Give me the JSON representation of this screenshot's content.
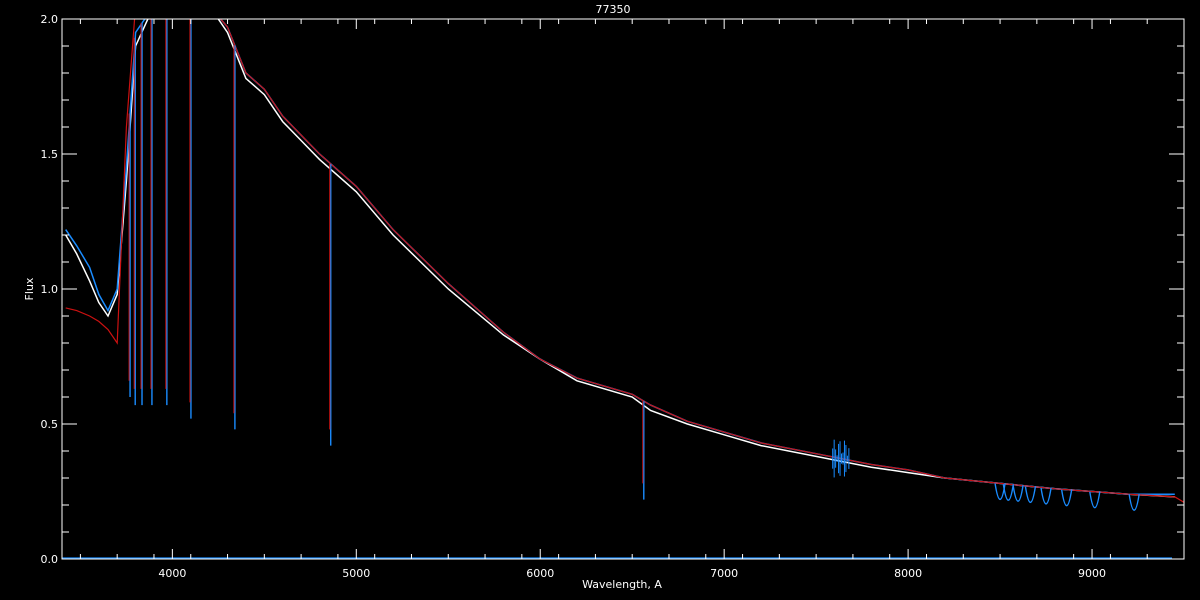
{
  "chart_data": {
    "type": "line",
    "title": "77350",
    "xlabel": "Wavelength, A",
    "ylabel": "Flux",
    "xlim": [
      3400,
      9500
    ],
    "ylim": [
      0.0,
      2.0
    ],
    "x_ticks": [
      4000,
      5000,
      6000,
      7000,
      8000,
      9000
    ],
    "x_tick_labels": [
      "4000",
      "5000",
      "6000",
      "7000",
      "8000",
      "9000"
    ],
    "y_ticks": [
      0.0,
      0.5,
      1.0,
      1.5,
      2.0
    ],
    "y_tick_labels": [
      "0.0",
      "0.5",
      "1.0",
      "1.5",
      "2.0"
    ],
    "grid": false,
    "background": "#000000",
    "series": [
      {
        "color": "#ffffff",
        "x": [
          3420,
          3480,
          3550,
          3600,
          3650,
          3700,
          3750,
          3800,
          3900,
          4000,
          4100,
          4200,
          4300,
          4400,
          4500,
          4600,
          4700,
          4800,
          5000,
          5200,
          5500,
          5800,
          6000,
          6200,
          6500,
          6600,
          6800,
          7000,
          7200,
          7500,
          7800,
          8000,
          8200,
          8500,
          8800,
          9000,
          9200,
          9450
        ],
        "y": [
          1.2,
          1.13,
          1.03,
          0.95,
          0.9,
          0.98,
          1.4,
          1.9,
          2.05,
          2.05,
          2.05,
          2.05,
          1.95,
          1.78,
          1.72,
          1.62,
          1.55,
          1.48,
          1.36,
          1.2,
          1.0,
          0.83,
          0.74,
          0.66,
          0.6,
          0.55,
          0.5,
          0.46,
          0.42,
          0.38,
          0.34,
          0.32,
          0.3,
          0.28,
          0.26,
          0.25,
          0.24,
          0.23
        ]
      },
      {
        "color": "#1a8cff",
        "x": [
          3420,
          3480,
          3550,
          3600,
          3650,
          3700,
          3750,
          3800,
          3900,
          4000,
          4100,
          4200,
          4300,
          4400,
          4500,
          4600,
          4700,
          4800,
          5000,
          5200,
          5500,
          5800,
          6000,
          6200,
          6500,
          6600,
          6800,
          7000,
          7200,
          7500,
          7800,
          8000,
          8200,
          8500,
          8800,
          9000,
          9200,
          9450
        ],
        "y": [
          1.22,
          1.16,
          1.08,
          0.98,
          0.92,
          1.0,
          1.45,
          1.95,
          2.05,
          2.05,
          2.05,
          2.05,
          1.97,
          1.8,
          1.74,
          1.64,
          1.57,
          1.5,
          1.38,
          1.22,
          1.02,
          0.84,
          0.74,
          0.67,
          0.61,
          0.57,
          0.51,
          0.47,
          0.43,
          0.39,
          0.35,
          0.33,
          0.3,
          0.28,
          0.26,
          0.25,
          0.24,
          0.24
        ]
      },
      {
        "color": "#cc1111",
        "x": [
          3420,
          3480,
          3550,
          3600,
          3650,
          3700,
          3750,
          3800,
          3900,
          4000,
          4100,
          4200,
          4300,
          4400,
          4500,
          4600,
          4700,
          4800,
          5000,
          5200,
          5500,
          5800,
          6000,
          6200,
          6500,
          6600,
          6800,
          7000,
          7200,
          7500,
          7800,
          8000,
          8200,
          8500,
          8800,
          9000,
          9200,
          9450,
          9500
        ],
        "y": [
          0.93,
          0.92,
          0.9,
          0.88,
          0.85,
          0.8,
          1.6,
          2.05,
          2.05,
          2.05,
          2.05,
          2.05,
          1.97,
          1.8,
          1.74,
          1.64,
          1.57,
          1.5,
          1.38,
          1.22,
          1.02,
          0.84,
          0.74,
          0.67,
          0.61,
          0.57,
          0.51,
          0.47,
          0.43,
          0.39,
          0.35,
          0.33,
          0.3,
          0.28,
          0.26,
          0.25,
          0.24,
          0.23,
          0.21
        ]
      }
    ],
    "absorption_lines": [
      {
        "x": 3770,
        "depth_to": 0.6
      },
      {
        "x": 3798,
        "depth_to": 0.57
      },
      {
        "x": 3835,
        "depth_to": 0.57
      },
      {
        "x": 3889,
        "depth_to": 0.57
      },
      {
        "x": 3970,
        "depth_to": 0.57
      },
      {
        "x": 4101,
        "depth_to": 0.52
      },
      {
        "x": 4340,
        "depth_to": 0.48
      },
      {
        "x": 4861,
        "depth_to": 0.42
      },
      {
        "x": 6563,
        "depth_to": 0.22
      }
    ],
    "paschen_lines": [
      8500,
      8545,
      8598,
      8665,
      8750,
      8862,
      9015,
      9229
    ],
    "telluric_band": {
      "x_start": 7590,
      "x_end": 7680
    },
    "baseline": {
      "color": "#1a8cff",
      "y": 0.0
    }
  }
}
